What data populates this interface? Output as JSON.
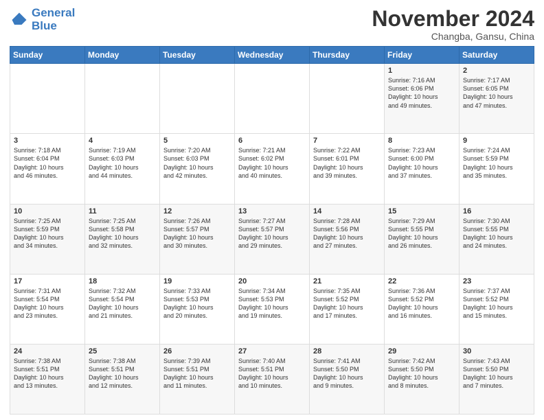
{
  "header": {
    "logo_line1": "General",
    "logo_line2": "Blue",
    "month_title": "November 2024",
    "subtitle": "Changba, Gansu, China"
  },
  "weekdays": [
    "Sunday",
    "Monday",
    "Tuesday",
    "Wednesday",
    "Thursday",
    "Friday",
    "Saturday"
  ],
  "weeks": [
    [
      {
        "day": "",
        "info": ""
      },
      {
        "day": "",
        "info": ""
      },
      {
        "day": "",
        "info": ""
      },
      {
        "day": "",
        "info": ""
      },
      {
        "day": "",
        "info": ""
      },
      {
        "day": "1",
        "info": "Sunrise: 7:16 AM\nSunset: 6:06 PM\nDaylight: 10 hours\nand 49 minutes."
      },
      {
        "day": "2",
        "info": "Sunrise: 7:17 AM\nSunset: 6:05 PM\nDaylight: 10 hours\nand 47 minutes."
      }
    ],
    [
      {
        "day": "3",
        "info": "Sunrise: 7:18 AM\nSunset: 6:04 PM\nDaylight: 10 hours\nand 46 minutes."
      },
      {
        "day": "4",
        "info": "Sunrise: 7:19 AM\nSunset: 6:03 PM\nDaylight: 10 hours\nand 44 minutes."
      },
      {
        "day": "5",
        "info": "Sunrise: 7:20 AM\nSunset: 6:03 PM\nDaylight: 10 hours\nand 42 minutes."
      },
      {
        "day": "6",
        "info": "Sunrise: 7:21 AM\nSunset: 6:02 PM\nDaylight: 10 hours\nand 40 minutes."
      },
      {
        "day": "7",
        "info": "Sunrise: 7:22 AM\nSunset: 6:01 PM\nDaylight: 10 hours\nand 39 minutes."
      },
      {
        "day": "8",
        "info": "Sunrise: 7:23 AM\nSunset: 6:00 PM\nDaylight: 10 hours\nand 37 minutes."
      },
      {
        "day": "9",
        "info": "Sunrise: 7:24 AM\nSunset: 5:59 PM\nDaylight: 10 hours\nand 35 minutes."
      }
    ],
    [
      {
        "day": "10",
        "info": "Sunrise: 7:25 AM\nSunset: 5:59 PM\nDaylight: 10 hours\nand 34 minutes."
      },
      {
        "day": "11",
        "info": "Sunrise: 7:25 AM\nSunset: 5:58 PM\nDaylight: 10 hours\nand 32 minutes."
      },
      {
        "day": "12",
        "info": "Sunrise: 7:26 AM\nSunset: 5:57 PM\nDaylight: 10 hours\nand 30 minutes."
      },
      {
        "day": "13",
        "info": "Sunrise: 7:27 AM\nSunset: 5:57 PM\nDaylight: 10 hours\nand 29 minutes."
      },
      {
        "day": "14",
        "info": "Sunrise: 7:28 AM\nSunset: 5:56 PM\nDaylight: 10 hours\nand 27 minutes."
      },
      {
        "day": "15",
        "info": "Sunrise: 7:29 AM\nSunset: 5:55 PM\nDaylight: 10 hours\nand 26 minutes."
      },
      {
        "day": "16",
        "info": "Sunrise: 7:30 AM\nSunset: 5:55 PM\nDaylight: 10 hours\nand 24 minutes."
      }
    ],
    [
      {
        "day": "17",
        "info": "Sunrise: 7:31 AM\nSunset: 5:54 PM\nDaylight: 10 hours\nand 23 minutes."
      },
      {
        "day": "18",
        "info": "Sunrise: 7:32 AM\nSunset: 5:54 PM\nDaylight: 10 hours\nand 21 minutes."
      },
      {
        "day": "19",
        "info": "Sunrise: 7:33 AM\nSunset: 5:53 PM\nDaylight: 10 hours\nand 20 minutes."
      },
      {
        "day": "20",
        "info": "Sunrise: 7:34 AM\nSunset: 5:53 PM\nDaylight: 10 hours\nand 19 minutes."
      },
      {
        "day": "21",
        "info": "Sunrise: 7:35 AM\nSunset: 5:52 PM\nDaylight: 10 hours\nand 17 minutes."
      },
      {
        "day": "22",
        "info": "Sunrise: 7:36 AM\nSunset: 5:52 PM\nDaylight: 10 hours\nand 16 minutes."
      },
      {
        "day": "23",
        "info": "Sunrise: 7:37 AM\nSunset: 5:52 PM\nDaylight: 10 hours\nand 15 minutes."
      }
    ],
    [
      {
        "day": "24",
        "info": "Sunrise: 7:38 AM\nSunset: 5:51 PM\nDaylight: 10 hours\nand 13 minutes."
      },
      {
        "day": "25",
        "info": "Sunrise: 7:38 AM\nSunset: 5:51 PM\nDaylight: 10 hours\nand 12 minutes."
      },
      {
        "day": "26",
        "info": "Sunrise: 7:39 AM\nSunset: 5:51 PM\nDaylight: 10 hours\nand 11 minutes."
      },
      {
        "day": "27",
        "info": "Sunrise: 7:40 AM\nSunset: 5:51 PM\nDaylight: 10 hours\nand 10 minutes."
      },
      {
        "day": "28",
        "info": "Sunrise: 7:41 AM\nSunset: 5:50 PM\nDaylight: 10 hours\nand 9 minutes."
      },
      {
        "day": "29",
        "info": "Sunrise: 7:42 AM\nSunset: 5:50 PM\nDaylight: 10 hours\nand 8 minutes."
      },
      {
        "day": "30",
        "info": "Sunrise: 7:43 AM\nSunset: 5:50 PM\nDaylight: 10 hours\nand 7 minutes."
      }
    ]
  ]
}
